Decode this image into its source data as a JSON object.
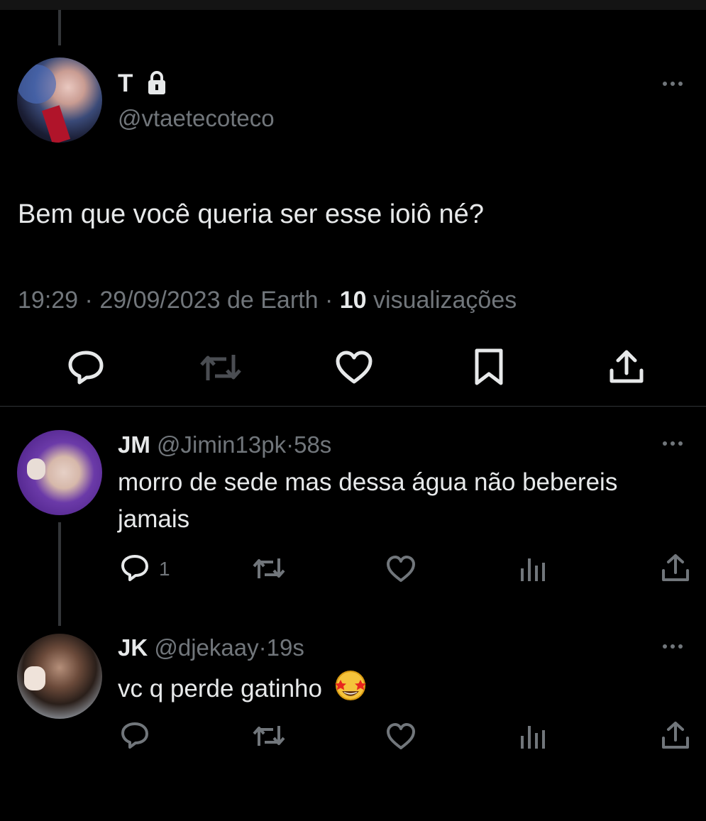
{
  "main_tweet": {
    "display_name": "T",
    "handle": "@vtaetecoteco",
    "text": "Bem que você queria ser esse ioiô né?",
    "time": "19:29",
    "date": "29/09/2023",
    "source_prefix": "de",
    "source": "Earth",
    "separator": "·",
    "views_count": "10",
    "views_label": "visualizações",
    "icons": [
      "reply-icon",
      "retweet-icon",
      "like-icon",
      "bookmark-icon",
      "share-icon"
    ]
  },
  "replies": [
    {
      "display_name": "JM",
      "handle": "@Jimin13pk",
      "separator": "·",
      "time": "58s",
      "text_line1": "morro de sede mas dessa água não bebereis",
      "text_line2": "jamais",
      "reply_count": "1"
    },
    {
      "display_name": "JK",
      "handle": "@djekaay",
      "separator": "·",
      "time": "19s",
      "text": "vc q perde gatinho",
      "emoji": "star-struck-emoji"
    }
  ],
  "colors": {
    "background": "#000000",
    "text": "#e7e9ea",
    "secondary_text": "#71767b",
    "divider": "#2f3336"
  }
}
